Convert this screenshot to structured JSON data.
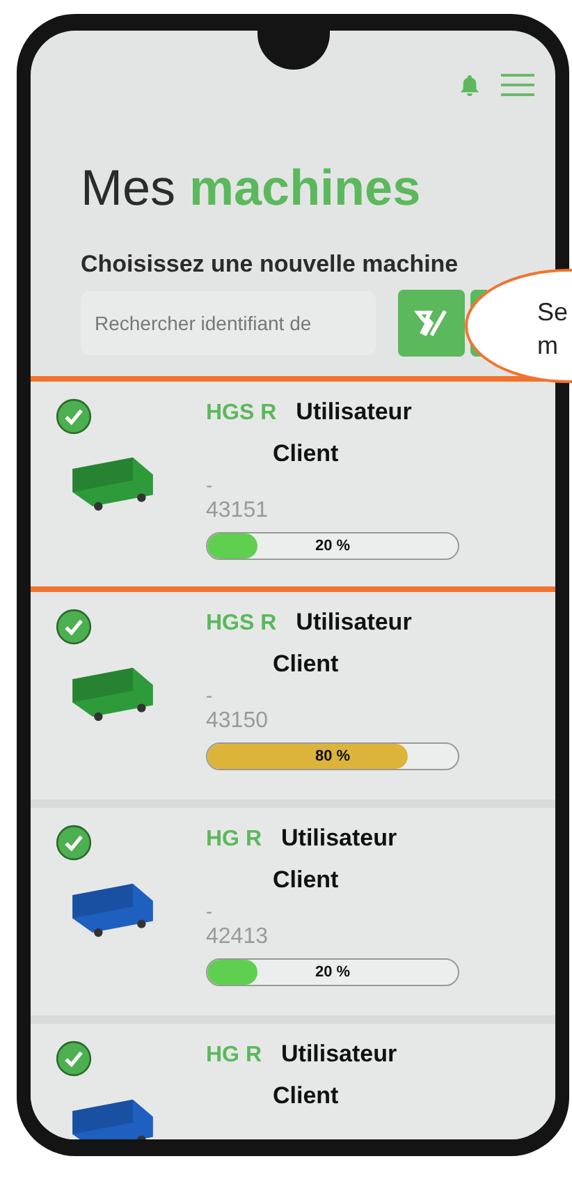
{
  "title": {
    "plain": "Mes",
    "accent": "machines"
  },
  "subtitle": "Choisissez une nouvelle machine",
  "search": {
    "placeholder": "Rechercher identifiant de"
  },
  "callout": {
    "lines": [
      "Se",
      "m"
    ]
  },
  "machines": [
    {
      "model": "HGS R",
      "user": "Utilisateur",
      "client": "Client",
      "dash": "-",
      "number": "43151",
      "level": 0.2,
      "reading": "20 %",
      "checked": true,
      "color": "#2e9b3a",
      "highlighted": true
    },
    {
      "model": "HGS R",
      "user": "Utilisateur",
      "client": "Client",
      "dash": "-",
      "number": "43150",
      "level": 0.8,
      "reading": "80 %",
      "checked": true,
      "color": "#2e9b3a",
      "highlighted": false
    },
    {
      "model": "HG R",
      "user": "Utilisateur",
      "client": "Client",
      "dash": "-",
      "number": "42413",
      "level": 0.2,
      "reading": "20 %",
      "checked": true,
      "color": "#1f5fbf",
      "highlighted": false
    },
    {
      "model": "HG R",
      "user": "Utilisateur",
      "client": "Client",
      "checked": true,
      "color": "#1f5fbf",
      "highlighted": false
    }
  ]
}
